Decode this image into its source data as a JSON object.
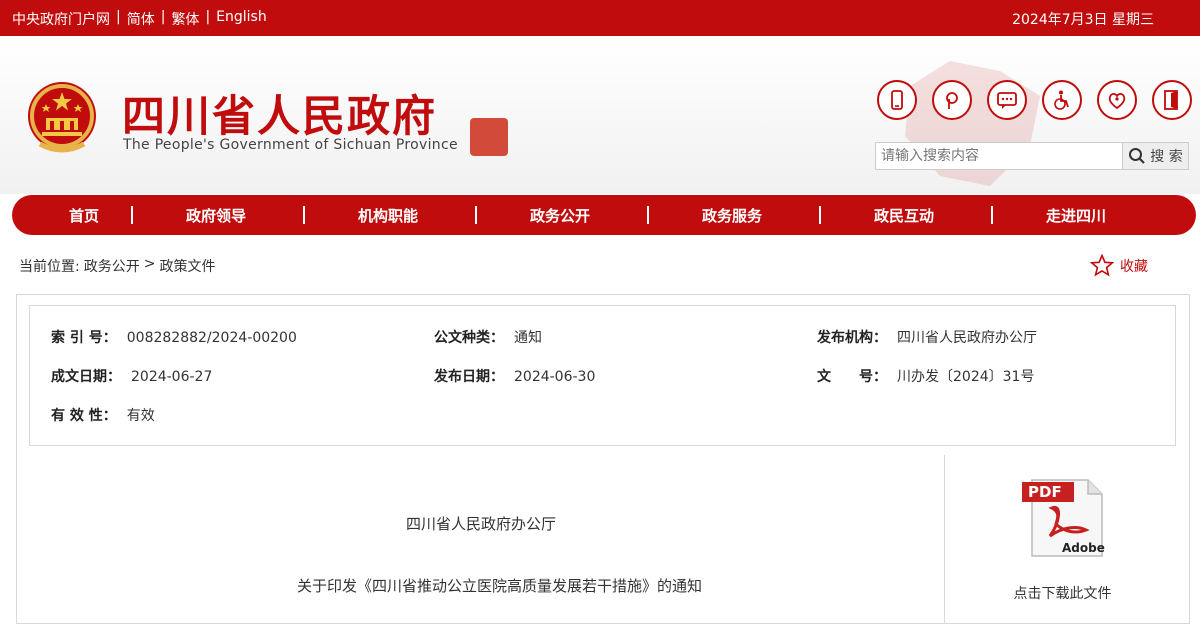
{
  "topbar": {
    "links": [
      "中央政府门户网",
      "简体",
      "繁体",
      "English"
    ],
    "separator": "|",
    "date": "2024年7月3日 星期三"
  },
  "header": {
    "title": "四川省人民政府",
    "subtitle": "The People's Government of Sichuan Province",
    "icons": [
      "mobile-icon",
      "weibo-icon",
      "message-icon",
      "wheelchair-icon",
      "elderly-care-icon",
      "exit-door-icon"
    ]
  },
  "search": {
    "placeholder": "请输入搜索内容",
    "button_label": "搜 索"
  },
  "nav": {
    "items": [
      "首页",
      "政府领导",
      "机构职能",
      "政务公开",
      "政务服务",
      "政民互动",
      "走进四川"
    ],
    "separator": "|"
  },
  "breadcrumb": {
    "prefix": "当前位置:",
    "items": [
      "政务公开",
      "政策文件"
    ],
    "separator": ">"
  },
  "favorite": {
    "label": "收藏"
  },
  "meta": {
    "index_no": {
      "label": "索 引 号：",
      "value": "008282882/2024-00200"
    },
    "doc_type": {
      "label": "公文种类：",
      "value": "通知"
    },
    "publisher": {
      "label": "发布机构：",
      "value": "四川省人民政府办公厅"
    },
    "created": {
      "label": "成文日期：",
      "value": "2024-06-27"
    },
    "published": {
      "label": "发布日期：",
      "value": "2024-06-30"
    },
    "doc_no": {
      "label": "文　　号：",
      "value": "川办发〔2024〕31号"
    },
    "validity": {
      "label": "有 效 性：",
      "value": "有效"
    }
  },
  "document": {
    "issuer": "四川省人民政府办公厅",
    "title": "关于印发《四川省推动公立医院高质量发展若干措施》的通知"
  },
  "download": {
    "pdf_label": "PDF",
    "adobe_label": "Adobe",
    "label": "点击下载此文件"
  },
  "colors": {
    "brand_red": "#c00c0c"
  }
}
